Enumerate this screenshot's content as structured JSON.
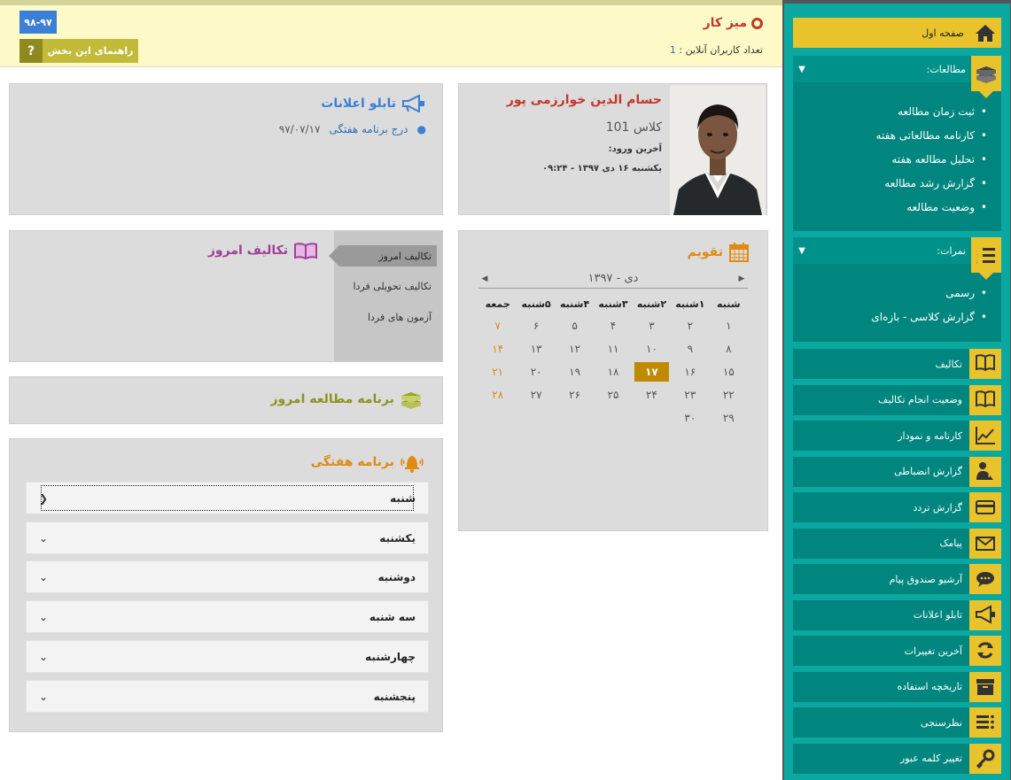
{
  "header": {
    "title": "میز کار",
    "online_label": "تعداد کاربران آنلاین :",
    "online_count": "1",
    "year_badge": "۹۸-۹۷",
    "guide_label": "راهنمای این بخش",
    "guide_icon": "?"
  },
  "profile": {
    "name": "حسام الدین خوارزمی پور",
    "class_label": "کلاس 101",
    "last_login_label": "آخرین ورود:",
    "last_login_value": "یکشنبه ۱۶ دی ۱۳۹۷ - ۰۹:۲۴"
  },
  "notices": {
    "title": "تابلو اعلانات",
    "items": [
      {
        "text": "درج برنامه هفتگی",
        "date": "۹۷/۰۷/۱۷"
      }
    ]
  },
  "calendar": {
    "title": "تقویم",
    "month": "دی - ۱۳۹۷",
    "weekdays": [
      "شنبه",
      "۱شنبه",
      "۲شنبه",
      "۳شنبه",
      "۴شنبه",
      "۵شنبه",
      "جمعه"
    ],
    "weeks": [
      [
        "۱",
        "۲",
        "۳",
        "۴",
        "۵",
        "۶",
        "۷"
      ],
      [
        "۸",
        "۹",
        "۱۰",
        "۱۱",
        "۱۲",
        "۱۳",
        "۱۴"
      ],
      [
        "۱۵",
        "۱۶",
        "۱۷",
        "۱۸",
        "۱۹",
        "۲۰",
        "۲۱"
      ],
      [
        "۲۲",
        "۲۳",
        "۲۴",
        "۲۵",
        "۲۶",
        "۲۷",
        "۲۸"
      ],
      [
        "۲۹",
        "۳۰",
        "",
        "",
        "",
        "",
        ""
      ]
    ],
    "today": "۱۷",
    "today_color": "#c08a00",
    "friday_color": "#d88a12"
  },
  "tasks": {
    "title": "تکالیف امروز",
    "tabs": [
      "تکالیف امروز",
      "تکالیف تحویلی فردا",
      "آزمون های فردا"
    ]
  },
  "study": {
    "title": "برنامه مطالعه امروز"
  },
  "weekly": {
    "title": "برنامه هفتگی",
    "days": [
      "شنبه",
      "یکشنبه",
      "دوشنبه",
      "سه شنبه",
      "چهارشنبه",
      "پنجشنبه"
    ]
  },
  "sidebar": {
    "home": "صفحه اول",
    "studies": {
      "label": "مطالعات:",
      "items": [
        "ثبت زمان مطالعه",
        "کارنامه مطالعاتی هفته",
        "تحلیل مطالعه هفته",
        "گزارش رشد مطالعه",
        "وضعیت مطالعه"
      ]
    },
    "grades": {
      "label": "نمرات:",
      "items": [
        "رسمی",
        "گزارش کلاسی - بازه‌ای"
      ]
    },
    "menu": [
      {
        "label": "تکالیف",
        "icon": "book-icon"
      },
      {
        "label": "وضعیت انجام تکالیف",
        "icon": "book-icon"
      },
      {
        "label": "کارنامه و نمودار",
        "icon": "chart-icon"
      },
      {
        "label": "گزارش انضباطی",
        "icon": "discipline-icon"
      },
      {
        "label": "گزارش تردد",
        "icon": "card-icon"
      },
      {
        "label": "پیامک",
        "icon": "envelope-icon"
      },
      {
        "label": "آرشیو صندوق پیام",
        "icon": "chat-icon"
      },
      {
        "label": "تابلو اعلانات",
        "icon": "megaphone-icon"
      },
      {
        "label": "آخرین تغییرات",
        "icon": "refresh-icon"
      },
      {
        "label": "تاریخچه استفاده",
        "icon": "archive-icon"
      },
      {
        "label": "نظرسنجی",
        "icon": "list-icon"
      },
      {
        "label": "تغییر کلمه عبور",
        "icon": "key-icon"
      }
    ]
  },
  "colors": {
    "sidebar": "#0aa8a0",
    "accent_yellow": "#e8c32c",
    "header_bg": "#fdfac8",
    "title_red": "#c0392b"
  }
}
